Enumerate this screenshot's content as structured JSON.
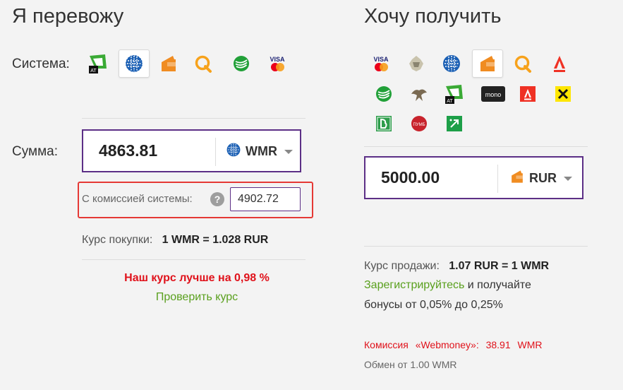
{
  "left": {
    "title": "Я перевожу",
    "system_label": "Система:",
    "amount_label": "Сумма:",
    "amount_value": "4863.81",
    "currency": "WMR",
    "commission_label": "С комиссией системы:",
    "help_glyph": "?",
    "commission_value": "4902.72",
    "rate_label": "Курс покупки:",
    "rate_value": "1 WMR = 1.028 RUR",
    "better_text": "Наш курс лучше на 0,98 %",
    "check_link": "Проверить курс",
    "systems": [
      "privat-at",
      "webmoney",
      "yandex-money",
      "qiwi",
      "sberbank",
      "visa-mastercard"
    ],
    "selected_system": "webmoney"
  },
  "right": {
    "title": "Хочу получить",
    "amount_value": "5000.00",
    "currency": "RUR",
    "sale_label": "Курс продажи:",
    "sale_value": "1.07 RUR = 1 WMR",
    "register_link": "Зарегистрируйтесь",
    "register_rest": " и получайте",
    "bonus_text": "бонусы от 0,05% до 0,25%",
    "fee_label": "Комиссия",
    "fee_system": "«Webmoney»:",
    "fee_amount": "38.91",
    "fee_currency": "WMR",
    "min_exchange": "Обмен от 1.00 WMR",
    "systems": [
      "visa-mastercard",
      "tinkoff",
      "webmoney",
      "yandex-money",
      "qiwi",
      "alfa-bank",
      "sberbank",
      "eagle",
      "privat-at",
      "mono",
      "alfa-red",
      "raiffeisen",
      "green-b",
      "pumb",
      "green-corner"
    ],
    "selected_system": "yandex-money",
    "icon_texts": {
      "at": "AT",
      "mono": "mono",
      "pumb": "ПУМБ",
      "visa": "VISA"
    }
  },
  "colors": {
    "accent_border": "#5c2f86",
    "commission_border": "#e53935",
    "red_text": "#e0121b",
    "green_link": "#5aa01e"
  }
}
